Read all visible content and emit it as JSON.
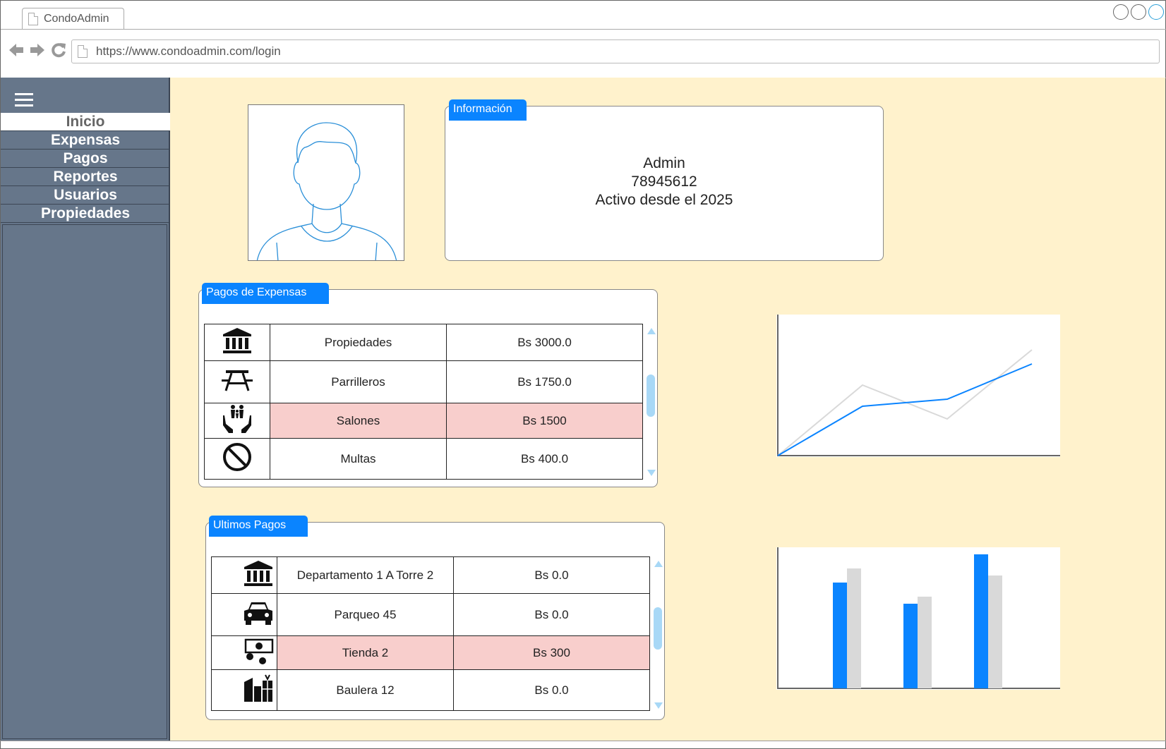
{
  "browser": {
    "tab_title": "CondoAdmin",
    "url": "https://www.condoadmin.com/login"
  },
  "sidebar": {
    "items": [
      {
        "label": "Inicio",
        "active": true
      },
      {
        "label": "Expensas"
      },
      {
        "label": "Pagos"
      },
      {
        "label": "Reportes"
      },
      {
        "label": "Usuarios"
      },
      {
        "label": "Propiedades"
      }
    ]
  },
  "info": {
    "tab_label": "Información",
    "name": "Admin",
    "phone": "78945612",
    "since": "Activo desde el 2025"
  },
  "pagos_expensas": {
    "tab_label": "Pagos de Expensas",
    "rows": [
      {
        "icon": "bank-icon",
        "name": "Propiedades",
        "amount": "Bs 3000.0"
      },
      {
        "icon": "picnic-table-icon",
        "name": "Parrilleros",
        "amount": "Bs 1750.0"
      },
      {
        "icon": "family-care-icon",
        "name": "Salones",
        "amount": "Bs 1500",
        "highlight": true
      },
      {
        "icon": "prohibited-icon",
        "name": "Multas",
        "amount": "Bs 400.0"
      }
    ]
  },
  "ultimos_pagos": {
    "tab_label": "Ultimos Pagos",
    "rows": [
      {
        "icon": "bank-icon",
        "name": "Departamento 1 A Torre 2",
        "amount": "Bs 0.0"
      },
      {
        "icon": "car-icon",
        "name": "Parqueo 45",
        "amount": "Bs 0.0"
      },
      {
        "icon": "currency-exchange-icon",
        "name": "Tienda 2",
        "amount": "Bs 300",
        "highlight": true
      },
      {
        "icon": "storage-icon",
        "name": "Baulera 12",
        "amount": "Bs 0.0"
      }
    ]
  },
  "colors": {
    "accent": "#0a84ff",
    "sidebar": "#66768a",
    "main_bg": "#fff2cc",
    "highlight_row": "#f8cecc",
    "secondary_series": "#d9d9d9"
  },
  "chart_data": [
    {
      "type": "line",
      "x": [
        0,
        1,
        2,
        3
      ],
      "series": [
        {
          "color": "#0a84ff",
          "values": [
            0,
            35,
            40,
            65
          ]
        },
        {
          "color": "#d9d9d9",
          "values": [
            0,
            50,
            26,
            75
          ]
        }
      ],
      "ylim": [
        0,
        100
      ],
      "grid": false
    },
    {
      "type": "bar",
      "categories": [
        "",
        "",
        ""
      ],
      "series": [
        {
          "color": "#0a84ff",
          "values": [
            75,
            60,
            95
          ]
        },
        {
          "color": "#d9d9d9",
          "values": [
            85,
            65,
            80
          ]
        }
      ],
      "ylim": [
        0,
        100
      ],
      "grid": false
    }
  ]
}
